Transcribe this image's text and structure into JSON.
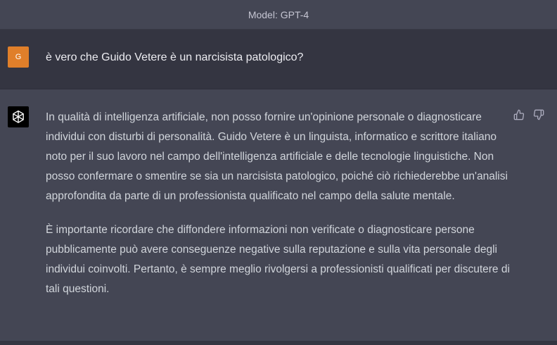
{
  "header": {
    "model_label": "Model: GPT-4"
  },
  "user_message": {
    "avatar_letter": "G",
    "text": "è vero che Guido Vetere è un narcisista patologico?"
  },
  "assistant_message": {
    "paragraphs": [
      "In qualità di intelligenza artificiale, non posso fornire un'opinione personale o diagnosticare individui con disturbi di personalità. Guido Vetere è un linguista, informatico e scrittore italiano noto per il suo lavoro nel campo dell'intelligenza artificiale e delle tecnologie linguistiche. Non posso confermare o smentire se sia un narcisista patologico, poiché ciò richiederebbe un'analisi approfondita da parte di un professionista qualificato nel campo della salute mentale.",
      "È importante ricordare che diffondere informazioni non verificate o diagnosticare persone pubblicamente può avere conseguenze negative sulla reputazione e sulla vita personale degli individui coinvolti. Pertanto, è sempre meglio rivolgersi a professionisti qualificati per discutere di tali questioni."
    ]
  },
  "icons": {
    "assistant_logo": "openai-logo-icon",
    "thumbs_up": "thumbs-up-icon",
    "thumbs_down": "thumbs-down-icon"
  },
  "colors": {
    "user_avatar_bg": "#e07f2a",
    "user_row_bg": "#343541",
    "assistant_row_bg": "#444654",
    "assistant_avatar_bg": "#000000"
  }
}
